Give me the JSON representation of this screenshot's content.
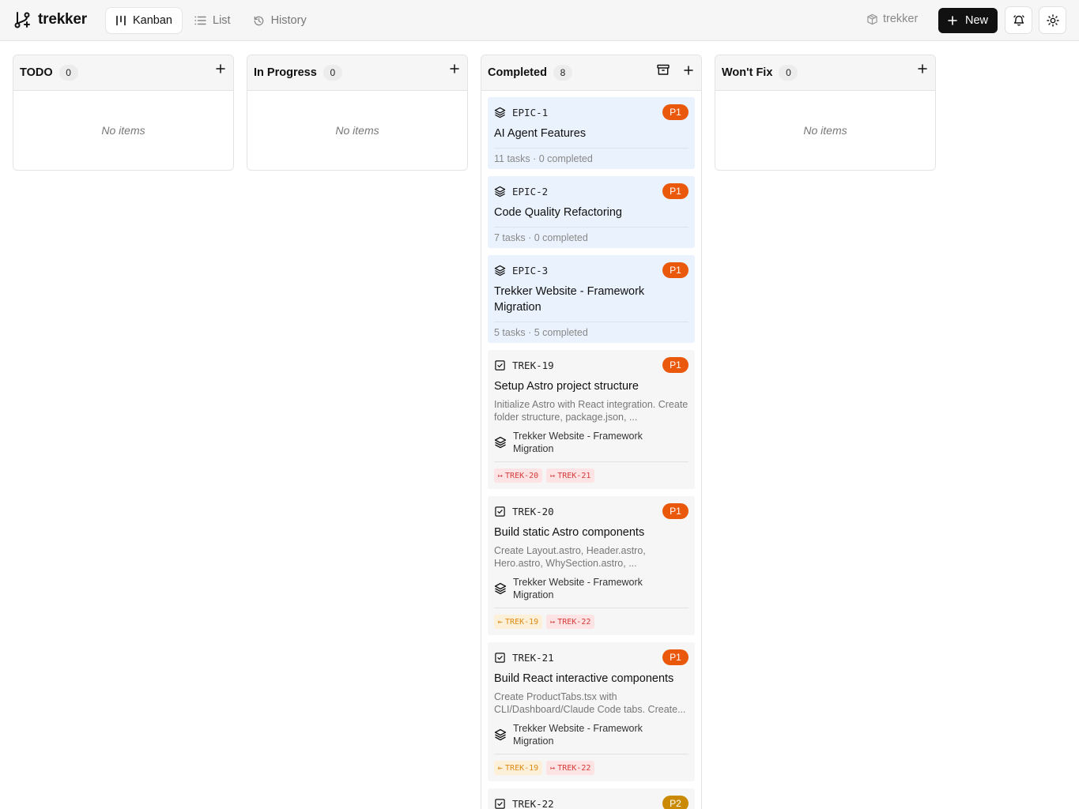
{
  "app": {
    "name": "trekker"
  },
  "nav": {
    "tabs": [
      {
        "label": "Kanban"
      },
      {
        "label": "List"
      },
      {
        "label": "History"
      }
    ]
  },
  "header": {
    "project": "trekker",
    "new_label": "New"
  },
  "colors": {
    "p1": "#ea580c",
    "p2": "#ca8a04",
    "epic_bg": "#eaf2fd",
    "task_bg": "#f6f6f6"
  },
  "columns": [
    {
      "title": "TODO",
      "count": "0",
      "empty": "No items"
    },
    {
      "title": "In Progress",
      "count": "0",
      "empty": "No items"
    },
    {
      "title": "Completed",
      "count": "8"
    },
    {
      "title": "Won't Fix",
      "count": "0",
      "empty": "No items"
    }
  ],
  "cards": [
    {
      "id": "EPIC-1",
      "priority": "P1",
      "title": "AI Agent Features",
      "meta": "11 tasks · 0 completed",
      "icon": "layers-icon"
    },
    {
      "id": "EPIC-2",
      "priority": "P1",
      "title": "Code Quality Refactoring",
      "meta": "7 tasks · 0 completed",
      "icon": "layers-icon"
    },
    {
      "id": "EPIC-3",
      "priority": "P1",
      "title": "Trekker Website - Framework Migration",
      "meta": "5 tasks · 5 completed",
      "icon": "layers-icon"
    },
    {
      "id": "TREK-19",
      "priority": "P1",
      "title": "Setup Astro project structure",
      "desc": "Initialize Astro with React integration. Create folder structure, package.json, ...",
      "epic": "Trekker Website - Framework Migration",
      "icon": "checkbox-icon",
      "deps": [
        {
          "label": "TREK-20",
          "kind": "blocks"
        },
        {
          "label": "TREK-21",
          "kind": "blocks"
        }
      ]
    },
    {
      "id": "TREK-20",
      "priority": "P1",
      "title": "Build static Astro components",
      "desc": "Create Layout.astro, Header.astro, Hero.astro, WhySection.astro, ...",
      "epic": "Trekker Website - Framework Migration",
      "icon": "checkbox-icon",
      "deps": [
        {
          "label": "TREK-19",
          "kind": "blocked"
        },
        {
          "label": "TREK-22",
          "kind": "blocks"
        }
      ]
    },
    {
      "id": "TREK-21",
      "priority": "P1",
      "title": "Build React interactive components",
      "desc": "Create ProductTabs.tsx with CLI/Dashboard/Claude Code tabs. Create...",
      "epic": "Trekker Website - Framework Migration",
      "icon": "checkbox-icon",
      "deps": [
        {
          "label": "TREK-19",
          "kind": "blocked"
        },
        {
          "label": "TREK-22",
          "kind": "blocks"
        }
      ]
    },
    {
      "id": "TREK-22",
      "priority": "P2",
      "icon": "checkbox-icon"
    }
  ]
}
